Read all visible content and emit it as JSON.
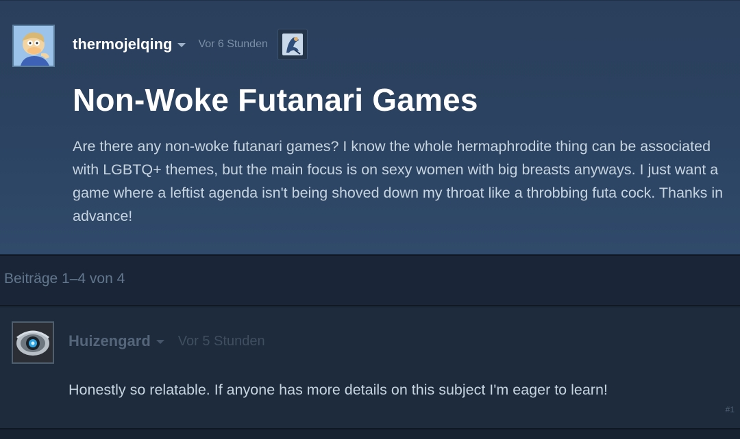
{
  "topic": {
    "author": "thermojelqing",
    "timestamp": "Vor 6 Stunden",
    "title": "Non-Woke Futanari Games",
    "body": "Are there any non-woke futanari games? I know the whole hermaphrodite thing can be associated with LGBTQ+ themes, but the main focus is on sexy women with big breasts anyways. I just want a game where a leftist agenda isn't being shoved down my throat like a throbbing futa cock. Thanks in advance!"
  },
  "posts_bar": {
    "count_label": "Beiträge 1–4 von 4"
  },
  "reply": {
    "author": "Huizengard",
    "timestamp": "Vor 5 Stunden",
    "body": "Honestly so relatable. If anyone has more details on this subject I'm eager to learn!",
    "post_number": "#1"
  },
  "colors": {
    "page_bg": "#1b2838",
    "topic_bg": "#2b4260",
    "body_text": "#c6d4df",
    "muted_text": "#62778d"
  },
  "icons": {
    "author_avatar": "cartoon-character-avatar",
    "author_badge": "profile-badge-icon",
    "reply_avatar": "robot-eye-avatar",
    "author_menu": "chevron-down-icon"
  }
}
